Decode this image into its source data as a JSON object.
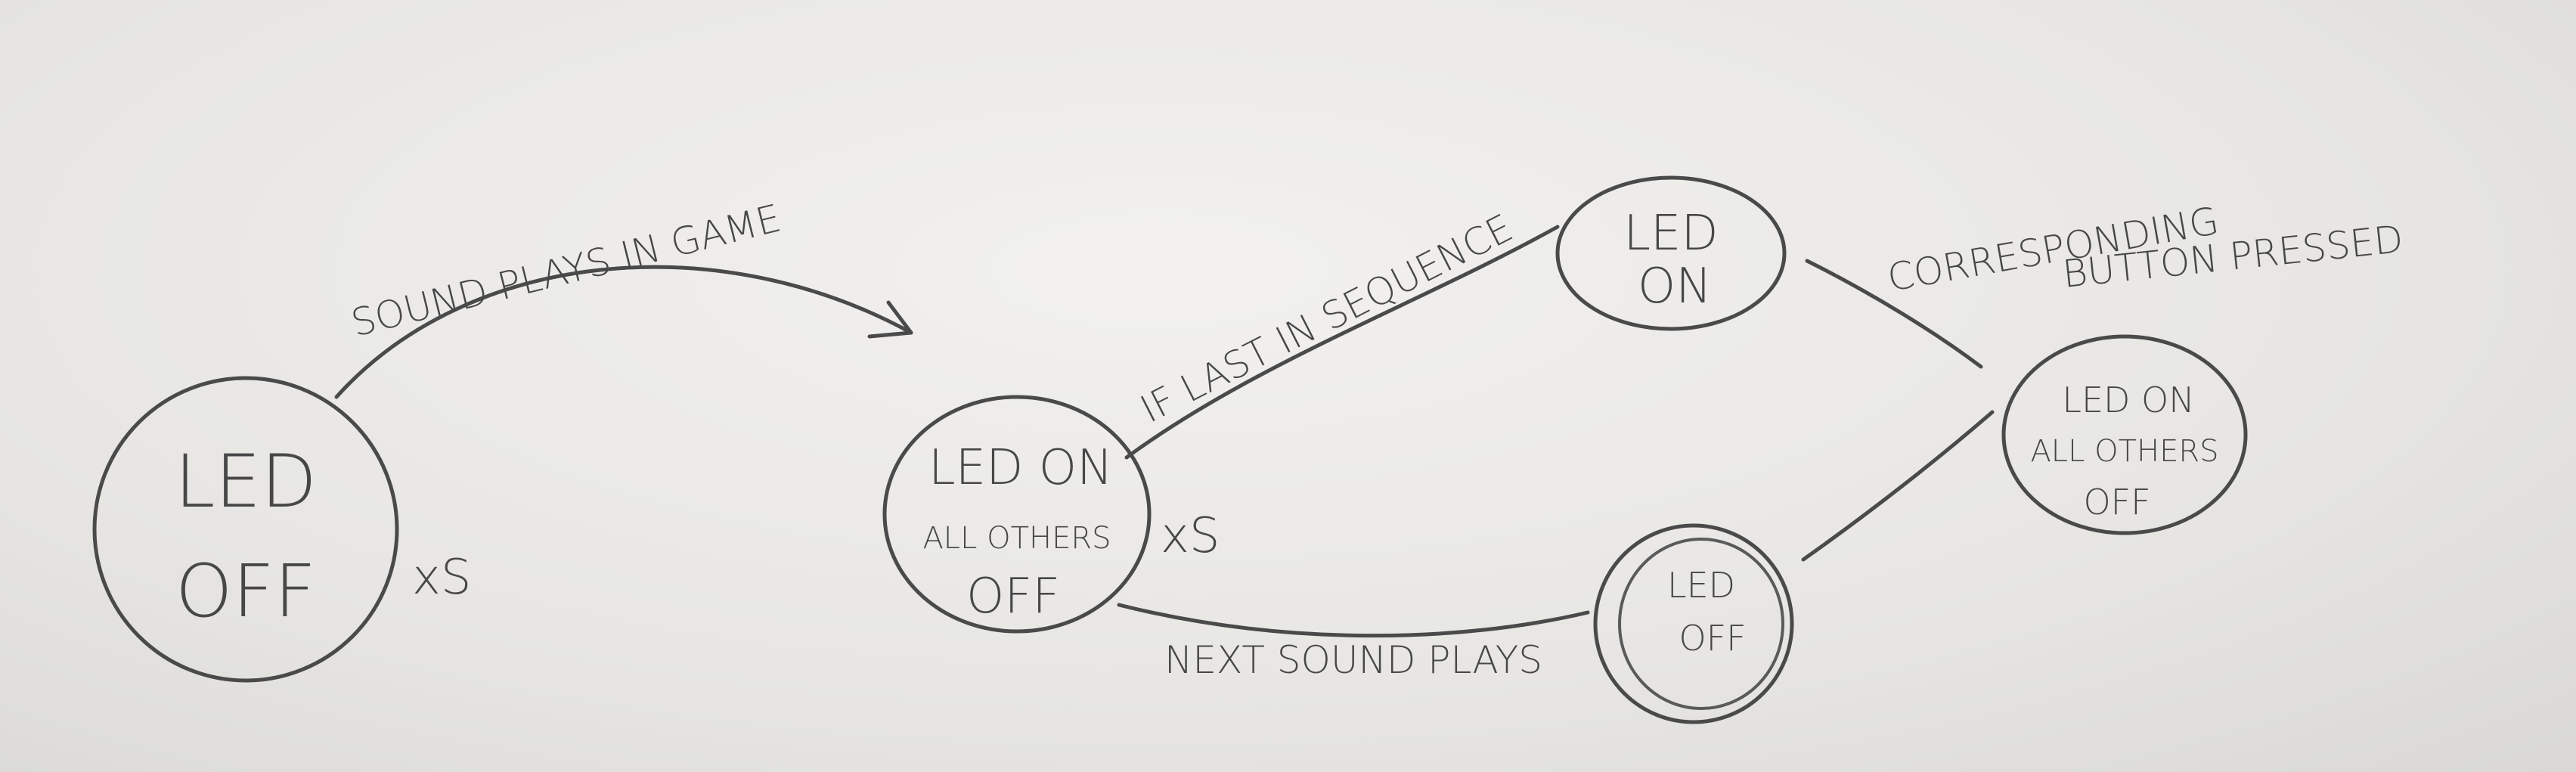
{
  "states": {
    "s1": {
      "line1": "LED",
      "line2": "OFF",
      "mark": "xS"
    },
    "s2": {
      "line1": "LED ON",
      "line2": "ALL OTHERS",
      "line3": "OFF",
      "mark": "xS"
    },
    "s3": {
      "line1": "LED",
      "line2": "ON"
    },
    "s4": {
      "line1": "LED",
      "line2": "OFF"
    },
    "s5": {
      "line1": "LED ON",
      "line2": "ALL OTHERS",
      "line3": "OFF"
    }
  },
  "transitions": {
    "t1": "SOUND PLAYS IN GAME",
    "t2": "IF LAST IN SEQUENCE",
    "t3": "NEXT SOUND PLAYS",
    "t4_line1": "CORRESPONDING",
    "t4_line2": "BUTTON PRESSED"
  },
  "colors": {
    "ink": "#4a4a4a",
    "paper": "#e9e8e6"
  }
}
